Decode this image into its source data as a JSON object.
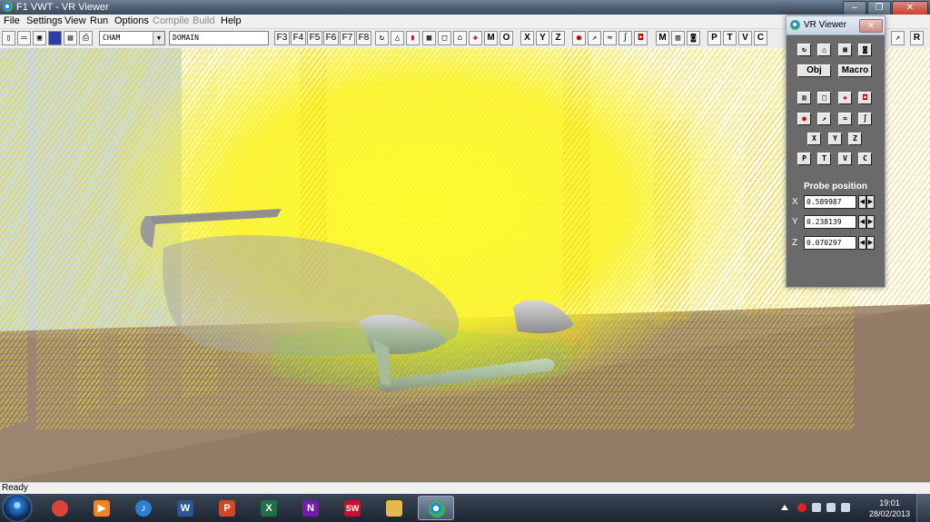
{
  "window": {
    "title": "F1 VWT - VR Viewer",
    "minimize": "–",
    "maximize": "❐",
    "close": "✕"
  },
  "menu": [
    "File",
    "Settings",
    "View",
    "Run",
    "Options",
    "Compile",
    "Build",
    "Help"
  ],
  "menu_disabled": [
    "Compile",
    "Build"
  ],
  "toolbar": {
    "combo1_value": "CHAM",
    "combo2_value": "DOMAIN",
    "fkeys": [
      "F3",
      "F4",
      "F5",
      "F6",
      "F7",
      "F8"
    ],
    "axis_buttons": [
      "X",
      "Y",
      "Z"
    ],
    "view_buttons": [
      "M",
      "O"
    ],
    "mode_buttons": [
      "P",
      "T",
      "V",
      "C"
    ],
    "right_letters": [
      "M",
      "R"
    ]
  },
  "status": {
    "text": "Ready"
  },
  "vr_panel": {
    "title": "VR Viewer",
    "obj_label": "Obj",
    "macro_label": "Macro",
    "axis_buttons": [
      "X",
      "Y",
      "Z"
    ],
    "mode_buttons": [
      "P",
      "T",
      "V",
      "C"
    ],
    "probe_title": "Probe position",
    "probe": [
      {
        "axis": "X",
        "value": "0.589987"
      },
      {
        "axis": "Y",
        "value": "0.238139"
      },
      {
        "axis": "Z",
        "value": "0.070297"
      }
    ]
  },
  "taskbar": {
    "apps": [
      {
        "name": "chrome",
        "label": "",
        "color": "#db4437"
      },
      {
        "name": "media-player",
        "label": "▶",
        "color": "#f58220"
      },
      {
        "name": "windows-media",
        "label": "♪",
        "color": "#2f7fd0"
      },
      {
        "name": "word",
        "label": "W",
        "color": "#2b5797"
      },
      {
        "name": "powerpoint",
        "label": "P",
        "color": "#d24726"
      },
      {
        "name": "excel",
        "label": "X",
        "color": "#1e7145"
      },
      {
        "name": "onenote",
        "label": "N",
        "color": "#7719aa"
      },
      {
        "name": "solidworks",
        "label": "SW",
        "color": "#c8102e"
      },
      {
        "name": "explorer",
        "label": "",
        "color": "#e8b84a"
      },
      {
        "name": "phoenics",
        "label": "",
        "color": "#1e88e5"
      }
    ],
    "time": "19:01",
    "date": "28/02/2013"
  }
}
